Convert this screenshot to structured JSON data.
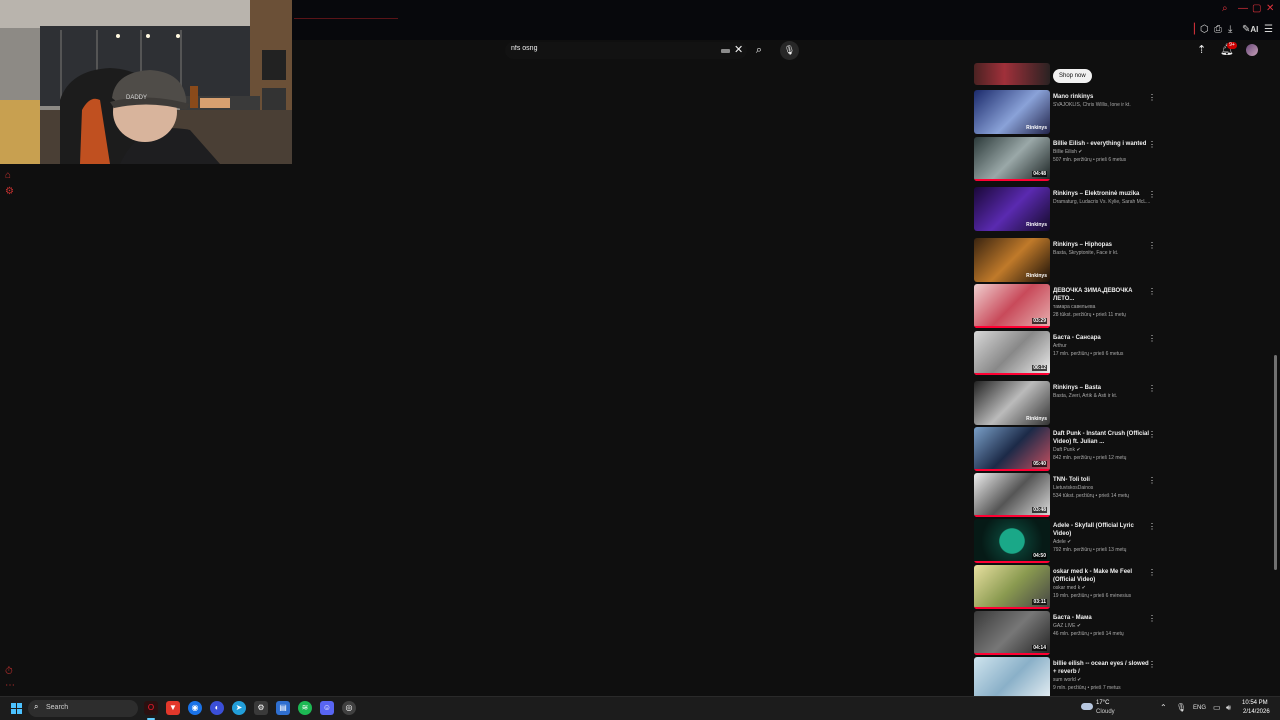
{
  "browser": {
    "ai_label": "AI"
  },
  "search": {
    "query": "nfs osng"
  },
  "notifications": {
    "badge": "9+"
  },
  "ad": {
    "button_label": "Shop now"
  },
  "recommendations": [
    {
      "title": "Mano rinkinys",
      "channel": "SVAJOKLIS, Chris Willis, Ione ir kt.",
      "meta": "",
      "badge": "Rinkinys",
      "thumb": "rinkinys"
    },
    {
      "title": "Billie Eilish - everything i wanted",
      "channel": "Billie Eilish ✔",
      "meta": "507 mln. peržiūrų • prieš 6 metus",
      "badge": "04:48",
      "thumb": "duration"
    },
    {
      "title": "Rinkinys – Elektroninė muzika",
      "channel": "Dramaturg, Ludacris Vs. Kylie, Sarah McL...",
      "meta": "",
      "badge": "Rinkinys",
      "thumb": "rinkinys"
    },
    {
      "title": "Rinkinys – Hiphopas",
      "channel": "Basta, Skryptonite, Face ir kt.",
      "meta": "",
      "badge": "Rinkinys",
      "thumb": "rinkinys"
    },
    {
      "title": "ДЕВОЧКА ЗИМА,ДЕВОЧКА ЛЕТО...",
      "channel": "тамара савельева",
      "meta": "28 tūkst. peržiūrų • prieš 11 metų",
      "badge": "03:29",
      "thumb": "duration"
    },
    {
      "title": "Баста - Сансара",
      "channel": "Arthur",
      "meta": "17 mln. peržiūrų • prieš 6 metus",
      "badge": "06:12",
      "thumb": "duration"
    },
    {
      "title": "Rinkinys – Basta",
      "channel": "Basta, Zveri, Artik & Asti ir kt.",
      "meta": "",
      "badge": "Rinkinys",
      "thumb": "rinkinys"
    },
    {
      "title": "Daft Punk - Instant Crush (Official Video) ft. Julian ...",
      "channel": "Daft Punk ✔",
      "meta": "842 mln. peržiūrų • prieš 12 metų",
      "badge": "05:40",
      "thumb": "duration"
    },
    {
      "title": "TNN- Toli toli",
      "channel": "LietuviskosDainos",
      "meta": "534 tūkst. peržiūrų • prieš 14 metų",
      "badge": "03:48",
      "thumb": "duration"
    },
    {
      "title": "Adele - Skyfall (Official Lyric Video)",
      "channel": "Adele ✔",
      "meta": "792 mln. peržiūrų • prieš 13 metų",
      "badge": "04:50",
      "thumb": "duration"
    },
    {
      "title": "oskar med k - Make Me Feel (Official Video)",
      "channel": "oskar med k ✔",
      "meta": "19 mln. peržiūrų • prieš 6 mėnesius",
      "badge": "03:11",
      "thumb": "duration"
    },
    {
      "title": "Баста - Мама",
      "channel": "GAZ LIVE ✔",
      "meta": "46 mln. peržiūrų • prieš 14 metų",
      "badge": "04:14",
      "thumb": "duration"
    },
    {
      "title": "billie eilish -- ocean eyes / slowed + reverb /",
      "channel": "sum world ✔",
      "meta": "9 mln. peržiūrų • prieš 7 metus",
      "badge": "",
      "thumb": "duration"
    }
  ],
  "taskbar": {
    "search_label": "Search",
    "weather_temp": "17°C",
    "weather_cond": "Cloudy",
    "language": "ENG",
    "time": "10:54 PM",
    "date": "2/14/2026"
  }
}
